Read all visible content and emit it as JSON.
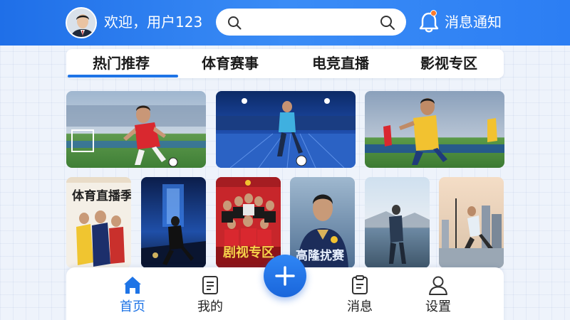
{
  "header": {
    "greeting": "欢迎，用户123",
    "search_placeholder": "",
    "notifications_label": "消息通知"
  },
  "tabs": [
    {
      "label": "热门推荐",
      "active": true
    },
    {
      "label": "体育赛事",
      "active": false
    },
    {
      "label": "电竞直播",
      "active": false
    },
    {
      "label": "影视专区",
      "active": false
    }
  ],
  "posters": {
    "live_season_title": "体育直播季",
    "drama_zone_title": "剧视专区",
    "highlight_title": "高隆扰赛"
  },
  "bottom_nav": [
    {
      "label": "首页",
      "icon": "home-icon",
      "active": true
    },
    {
      "label": "我的",
      "icon": "document-icon",
      "active": false
    },
    {
      "label": "消息",
      "icon": "message-icon",
      "active": false
    },
    {
      "label": "设置",
      "icon": "user-icon",
      "active": false
    }
  ],
  "fab": {
    "icon": "plus-icon"
  },
  "colors": {
    "accent": "#1e74e6",
    "header": "#2c7ef3",
    "badge": "#ff7a2a"
  }
}
